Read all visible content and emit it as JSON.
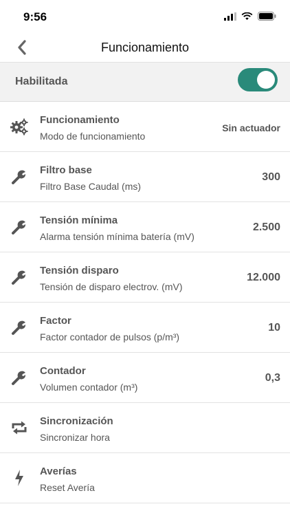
{
  "status_bar": {
    "time": "9:56"
  },
  "nav": {
    "title": "Funcionamiento"
  },
  "toggle": {
    "label": "Habilitada",
    "enabled": true,
    "accent": "#2a8a7a"
  },
  "items": [
    {
      "icon": "gears-icon",
      "title": "Funcionamiento",
      "subtitle": "Modo de funcionamiento",
      "value": "Sin actuador"
    },
    {
      "icon": "wrench-icon",
      "title": "Filtro base",
      "subtitle": "Filtro Base Caudal (ms)",
      "value": "300"
    },
    {
      "icon": "wrench-icon",
      "title": "Tensión mínima",
      "subtitle": "Alarma tensión mínima batería (mV)",
      "value": "2.500"
    },
    {
      "icon": "wrench-icon",
      "title": "Tensión disparo",
      "subtitle": "Tensión de disparo electrov. (mV)",
      "value": "12.000"
    },
    {
      "icon": "wrench-icon",
      "title": "Factor",
      "subtitle": "Factor contador de pulsos (p/m³)",
      "value": "10"
    },
    {
      "icon": "wrench-icon",
      "title": "Contador",
      "subtitle": "Volumen contador (m³)",
      "value": "0,3"
    },
    {
      "icon": "sync-icon",
      "title": "Sincronización",
      "subtitle": "Sincronizar hora",
      "value": ""
    },
    {
      "icon": "lightning-icon",
      "title": "Averías",
      "subtitle": "Reset Avería",
      "value": ""
    }
  ]
}
